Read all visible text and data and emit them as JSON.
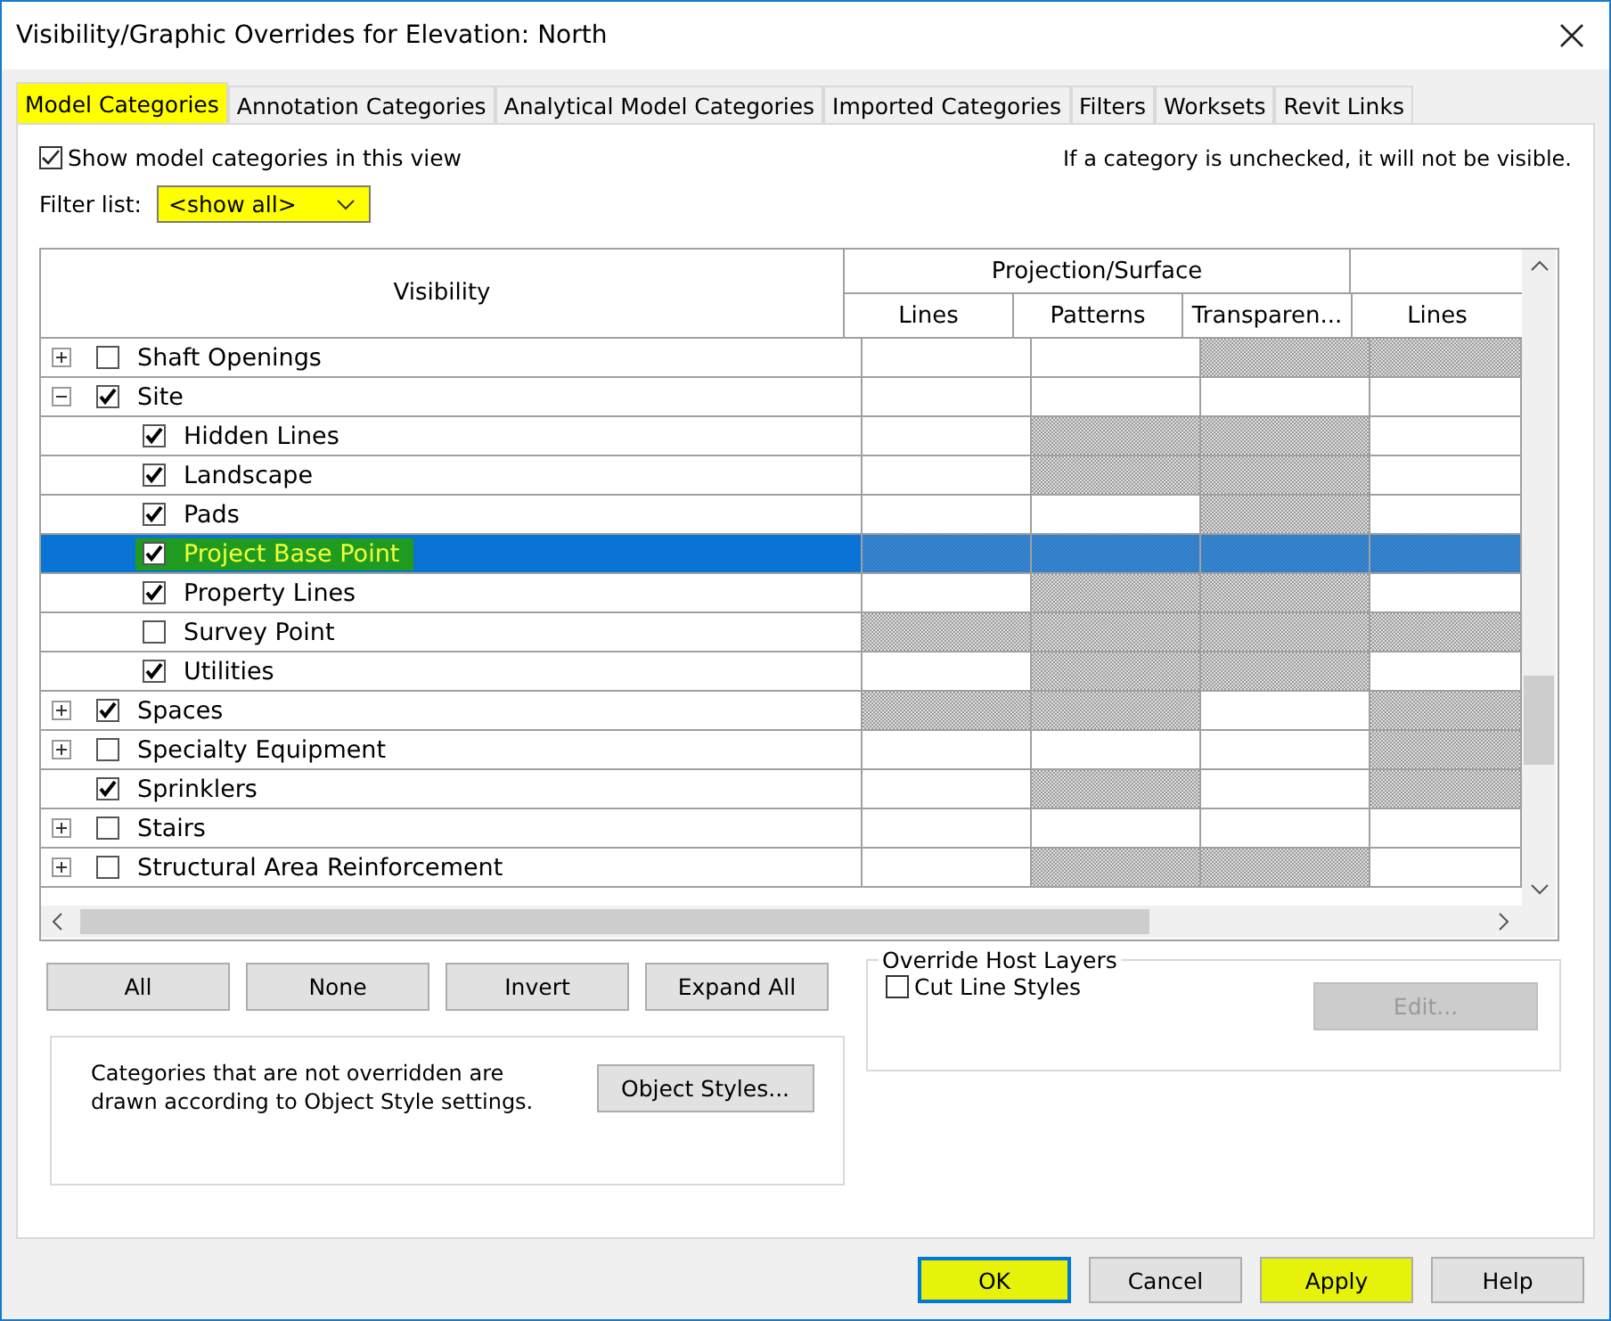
{
  "window": {
    "title": "Visibility/Graphic Overrides for Elevation: North"
  },
  "tabs": [
    {
      "label": "Model Categories",
      "selected": true,
      "highlighted": true
    },
    {
      "label": "Annotation Categories",
      "selected": false,
      "highlighted": false
    },
    {
      "label": "Analytical Model Categories",
      "selected": false,
      "highlighted": false
    },
    {
      "label": "Imported Categories",
      "selected": false,
      "highlighted": false
    },
    {
      "label": "Filters",
      "selected": false,
      "highlighted": false
    },
    {
      "label": "Worksets",
      "selected": false,
      "highlighted": false
    },
    {
      "label": "Revit Links",
      "selected": false,
      "highlighted": false
    }
  ],
  "show_categories": {
    "label": "Show model categories in this view",
    "checked": true
  },
  "hint": "If a category is unchecked, it will not be visible.",
  "filter": {
    "label": "Filter list:",
    "value": "<show all>",
    "highlighted": true
  },
  "table": {
    "column_groups": [
      {
        "label": "Projection/Surface"
      }
    ],
    "columns": [
      "Visibility",
      "Lines",
      "Patterns",
      "Transparen...",
      "Lines"
    ],
    "rows": [
      {
        "name": "Shaft Openings",
        "checked": false,
        "expanded": false,
        "selected": false,
        "highlighted": false,
        "hatched": [
          false,
          false,
          true,
          true
        ]
      },
      {
        "name": "Site",
        "checked": true,
        "expanded": true,
        "selected": false,
        "highlighted": false,
        "hatched": [
          false,
          false,
          false,
          false
        ],
        "children": [
          {
            "name": "Hidden Lines",
            "checked": true,
            "selected": false,
            "highlighted": false,
            "hatched": [
              false,
              true,
              true,
              false
            ]
          },
          {
            "name": "Landscape",
            "checked": true,
            "selected": false,
            "highlighted": false,
            "hatched": [
              false,
              true,
              true,
              false
            ]
          },
          {
            "name": "Pads",
            "checked": true,
            "selected": false,
            "highlighted": false,
            "hatched": [
              false,
              false,
              true,
              false
            ]
          },
          {
            "name": "Project Base Point",
            "checked": true,
            "selected": true,
            "highlighted": true,
            "hatched": [
              true,
              true,
              true,
              true
            ]
          },
          {
            "name": "Property Lines",
            "checked": true,
            "selected": false,
            "highlighted": false,
            "hatched": [
              false,
              true,
              true,
              false
            ]
          },
          {
            "name": "Survey Point",
            "checked": false,
            "selected": false,
            "highlighted": false,
            "hatched": [
              true,
              true,
              true,
              true
            ]
          },
          {
            "name": "Utilities",
            "checked": true,
            "selected": false,
            "highlighted": false,
            "hatched": [
              false,
              true,
              true,
              false
            ]
          }
        ]
      },
      {
        "name": "Spaces",
        "checked": true,
        "expanded": false,
        "selected": false,
        "highlighted": false,
        "hatched": [
          true,
          true,
          false,
          true
        ]
      },
      {
        "name": "Specialty Equipment",
        "checked": false,
        "expanded": false,
        "selected": false,
        "highlighted": false,
        "hatched": [
          false,
          false,
          false,
          true
        ]
      },
      {
        "name": "Sprinklers",
        "checked": true,
        "selected": false,
        "highlighted": false,
        "hatched": [
          false,
          true,
          false,
          true
        ]
      },
      {
        "name": "Stairs",
        "checked": false,
        "expanded": false,
        "selected": false,
        "highlighted": false,
        "hatched": [
          false,
          false,
          false,
          false
        ]
      },
      {
        "name": "Structural Area Reinforcement",
        "checked": false,
        "expanded": false,
        "selected": false,
        "highlighted": false,
        "hatched": [
          false,
          true,
          true,
          false
        ]
      }
    ]
  },
  "tree_buttons": [
    "All",
    "None",
    "Invert",
    "Expand All"
  ],
  "note": "Categories that are not overridden are drawn according to Object Style settings.",
  "object_styles_button": "Object Styles...",
  "override_host_layers": {
    "title": "Override Host Layers",
    "checkbox": {
      "label": "Cut Line Styles",
      "checked": false
    },
    "edit_button": {
      "label": "Edit...",
      "disabled": true
    }
  },
  "footer_buttons": [
    {
      "label": "OK",
      "default": true,
      "highlighted": true
    },
    {
      "label": "Cancel",
      "default": false,
      "highlighted": false
    },
    {
      "label": "Apply",
      "default": false,
      "highlighted": true
    },
    {
      "label": "Help",
      "default": false,
      "highlighted": false
    }
  ]
}
